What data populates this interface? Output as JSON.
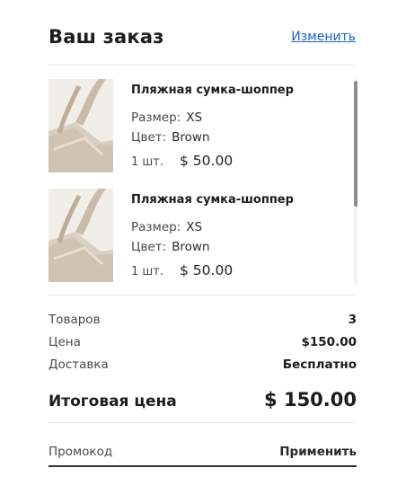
{
  "header": {
    "title": "Ваш заказ",
    "edit_label": "Изменить"
  },
  "items": [
    {
      "name": "Пляжная сумка-шоппер",
      "size_label": "Размер:",
      "size": "XS",
      "color_label": "Цвет:",
      "color": "Brown",
      "qty": "1 шт.",
      "price": "$ 50.00",
      "image_icon": "tote-bag-image"
    },
    {
      "name": "Пляжная сумка-шоппер",
      "size_label": "Размер:",
      "size": "XS",
      "color_label": "Цвет:",
      "color": "Brown",
      "qty": "1 шт.",
      "price": "$ 50.00",
      "image_icon": "tote-bag-image"
    }
  ],
  "summary": {
    "items_label": "Товаров",
    "items_value": "3",
    "price_label": "Цена",
    "price_value": "$150.00",
    "delivery_label": "Доставка",
    "delivery_value": "Бесплатно",
    "total_label": "Итоговая цена",
    "total_value": "$ 150.00"
  },
  "promo": {
    "placeholder": "Промокод",
    "value": "",
    "apply_label": "Применить"
  },
  "colors": {
    "accent_link": "#1a63c8",
    "text": "#1c1c1c",
    "muted": "#4a4a4a",
    "divider": "#e6e6e6"
  }
}
